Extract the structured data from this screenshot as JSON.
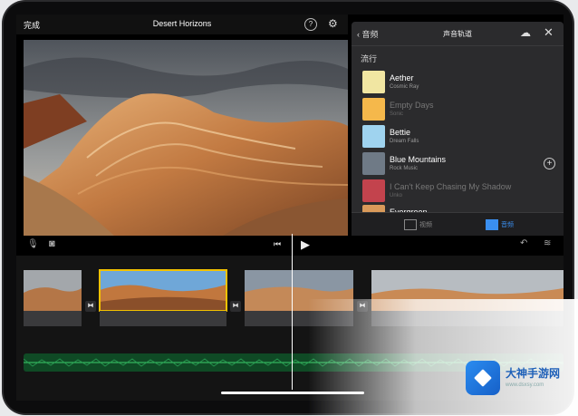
{
  "topbar": {
    "done_label": "完成",
    "project_title": "Desert Horizons"
  },
  "audio_panel": {
    "back_label": "音频",
    "title": "声音轨道",
    "section_label": "流行",
    "tracks": [
      {
        "name": "Aether",
        "sub": "Cosmic Ray",
        "color": "#f1e6a2",
        "dim": false,
        "add": false
      },
      {
        "name": "Empty Days",
        "sub": "Sonic",
        "color": "#f5b84b",
        "dim": true,
        "add": false
      },
      {
        "name": "Bettie",
        "sub": "Dream Falls",
        "color": "#9fd3ef",
        "dim": false,
        "add": false
      },
      {
        "name": "Blue Mountains",
        "sub": "Rock Music",
        "color": "#6f7a86",
        "dim": false,
        "add": true
      },
      {
        "name": "I Can't Keep Chasing My Shadow",
        "sub": "Unko",
        "color": "#c3434d",
        "dim": true,
        "add": false
      },
      {
        "name": "Evergreen",
        "sub": "",
        "color": "#d99a5a",
        "dim": false,
        "add": false
      }
    ],
    "tabs": [
      {
        "label": "视频"
      },
      {
        "label": "音频"
      }
    ]
  },
  "watermark": {
    "text": "大神手游网",
    "url": "www.dsxsy.com"
  },
  "colors": {
    "accent": "#3a8ff0",
    "selection": "#f3c200",
    "audio_track": "#0f4a25"
  },
  "icons": [
    "help-icon",
    "settings-icon",
    "chevron-left-icon",
    "cloud-download-icon",
    "close-icon",
    "add-icon",
    "mic-icon",
    "camera-icon",
    "skip-back-icon",
    "play-icon",
    "undo-icon",
    "waveform-icon"
  ]
}
